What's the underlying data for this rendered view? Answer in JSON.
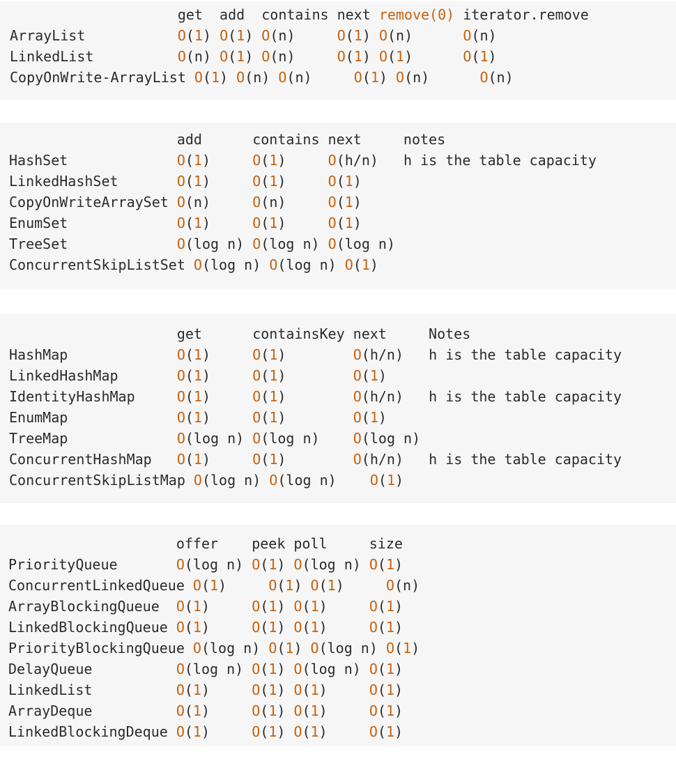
{
  "blocks": [
    {
      "id": "list-complexity-table",
      "lines": [
        "                    get  add  contains next remove(0) iterator.remove",
        "ArrayList           O(1) O(1) O(n)     O(1) O(n)      O(n)",
        "LinkedList          O(n) O(1) O(n)     O(1) O(1)      O(1)",
        "CopyOnWrite-ArrayList O(1) O(n) O(n)     O(1) O(n)      O(n)"
      ]
    },
    {
      "id": "set-complexity-table",
      "lines": [
        "                    add      contains next     notes",
        "HashSet             O(1)     O(1)     O(h/n)   h is the table capacity",
        "LinkedHashSet       O(1)     O(1)     O(1)",
        "CopyOnWriteArraySet O(n)     O(n)     O(1)",
        "EnumSet             O(1)     O(1)     O(1)",
        "TreeSet             O(log n) O(log n) O(log n)",
        "ConcurrentSkipListSet O(log n) O(log n) O(1)"
      ]
    },
    {
      "id": "map-complexity-table",
      "lines": [
        "                    get      containsKey next     Notes",
        "HashMap             O(1)     O(1)        O(h/n)   h is the table capacity",
        "LinkedHashMap       O(1)     O(1)        O(1)",
        "IdentityHashMap     O(1)     O(1)        O(h/n)   h is the table capacity",
        "EnumMap             O(1)     O(1)        O(1)",
        "TreeMap             O(log n) O(log n)    O(log n)",
        "ConcurrentHashMap   O(1)     O(1)        O(h/n)   h is the table capacity",
        "ConcurrentSkipListMap O(log n) O(log n)    O(1)"
      ]
    },
    {
      "id": "queue-complexity-table",
      "lines": [
        "                    offer    peek poll     size",
        "PriorityQueue       O(log n) O(1) O(log n) O(1)",
        "ConcurrentLinkedQueue O(1)     O(1) O(1)     O(n)",
        "ArrayBlockingQueue  O(1)     O(1) O(1)     O(1)",
        "LinkedBlockingQueue O(1)     O(1) O(1)     O(1)",
        "PriorityBlockingQueue O(log n) O(1) O(log n) O(1)",
        "DelayQueue          O(log n) O(1) O(log n) O(1)",
        "LinkedList          O(1)     O(1) O(1)     O(1)",
        "ArrayDeque          O(1)     O(1) O(1)     O(1)",
        "LinkedBlockingDeque O(1)     O(1) O(1)     O(1)"
      ]
    }
  ],
  "colors": {
    "background": "#f6f6f6",
    "text": "#2b2b2b",
    "number_highlight": "#c7620f"
  }
}
